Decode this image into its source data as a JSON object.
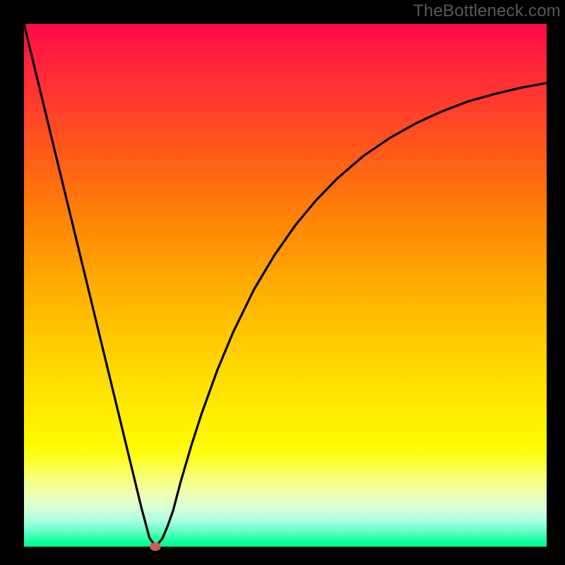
{
  "watermark": "TheBottleneck.com",
  "colors": {
    "background": "#000000",
    "curve": "#000000",
    "marker": "#cb5f58"
  },
  "chart_data": {
    "type": "line",
    "title": "",
    "xlabel": "",
    "ylabel": "",
    "xlim": [
      0,
      100
    ],
    "ylim": [
      0,
      100
    ],
    "grid": false,
    "legend": false,
    "series": [
      {
        "name": "bottleneck-curve",
        "x": [
          0.0,
          2.5,
          5.0,
          7.5,
          10.0,
          12.5,
          15.0,
          17.5,
          20.0,
          22.5,
          24.0,
          25.2,
          26.5,
          27.5,
          28.5,
          30.0,
          32.0,
          34.0,
          37.0,
          40.0,
          44.0,
          48.0,
          52.0,
          56.0,
          60.0,
          65.0,
          70.0,
          75.0,
          80.0,
          85.0,
          90.0,
          95.0,
          100.0
        ],
        "values": [
          100.0,
          89.7,
          79.4,
          69.1,
          58.8,
          48.5,
          38.2,
          27.9,
          17.6,
          7.3,
          1.7,
          0.0,
          1.6,
          4.0,
          6.8,
          12.5,
          19.3,
          25.5,
          33.8,
          41.0,
          49.2,
          55.9,
          61.6,
          66.4,
          70.5,
          74.8,
          78.2,
          81.0,
          83.3,
          85.2,
          86.6,
          87.8,
          88.7
        ]
      }
    ],
    "markers": [
      {
        "name": "optimal-point",
        "x": 25.2,
        "y": 0.0
      }
    ]
  }
}
